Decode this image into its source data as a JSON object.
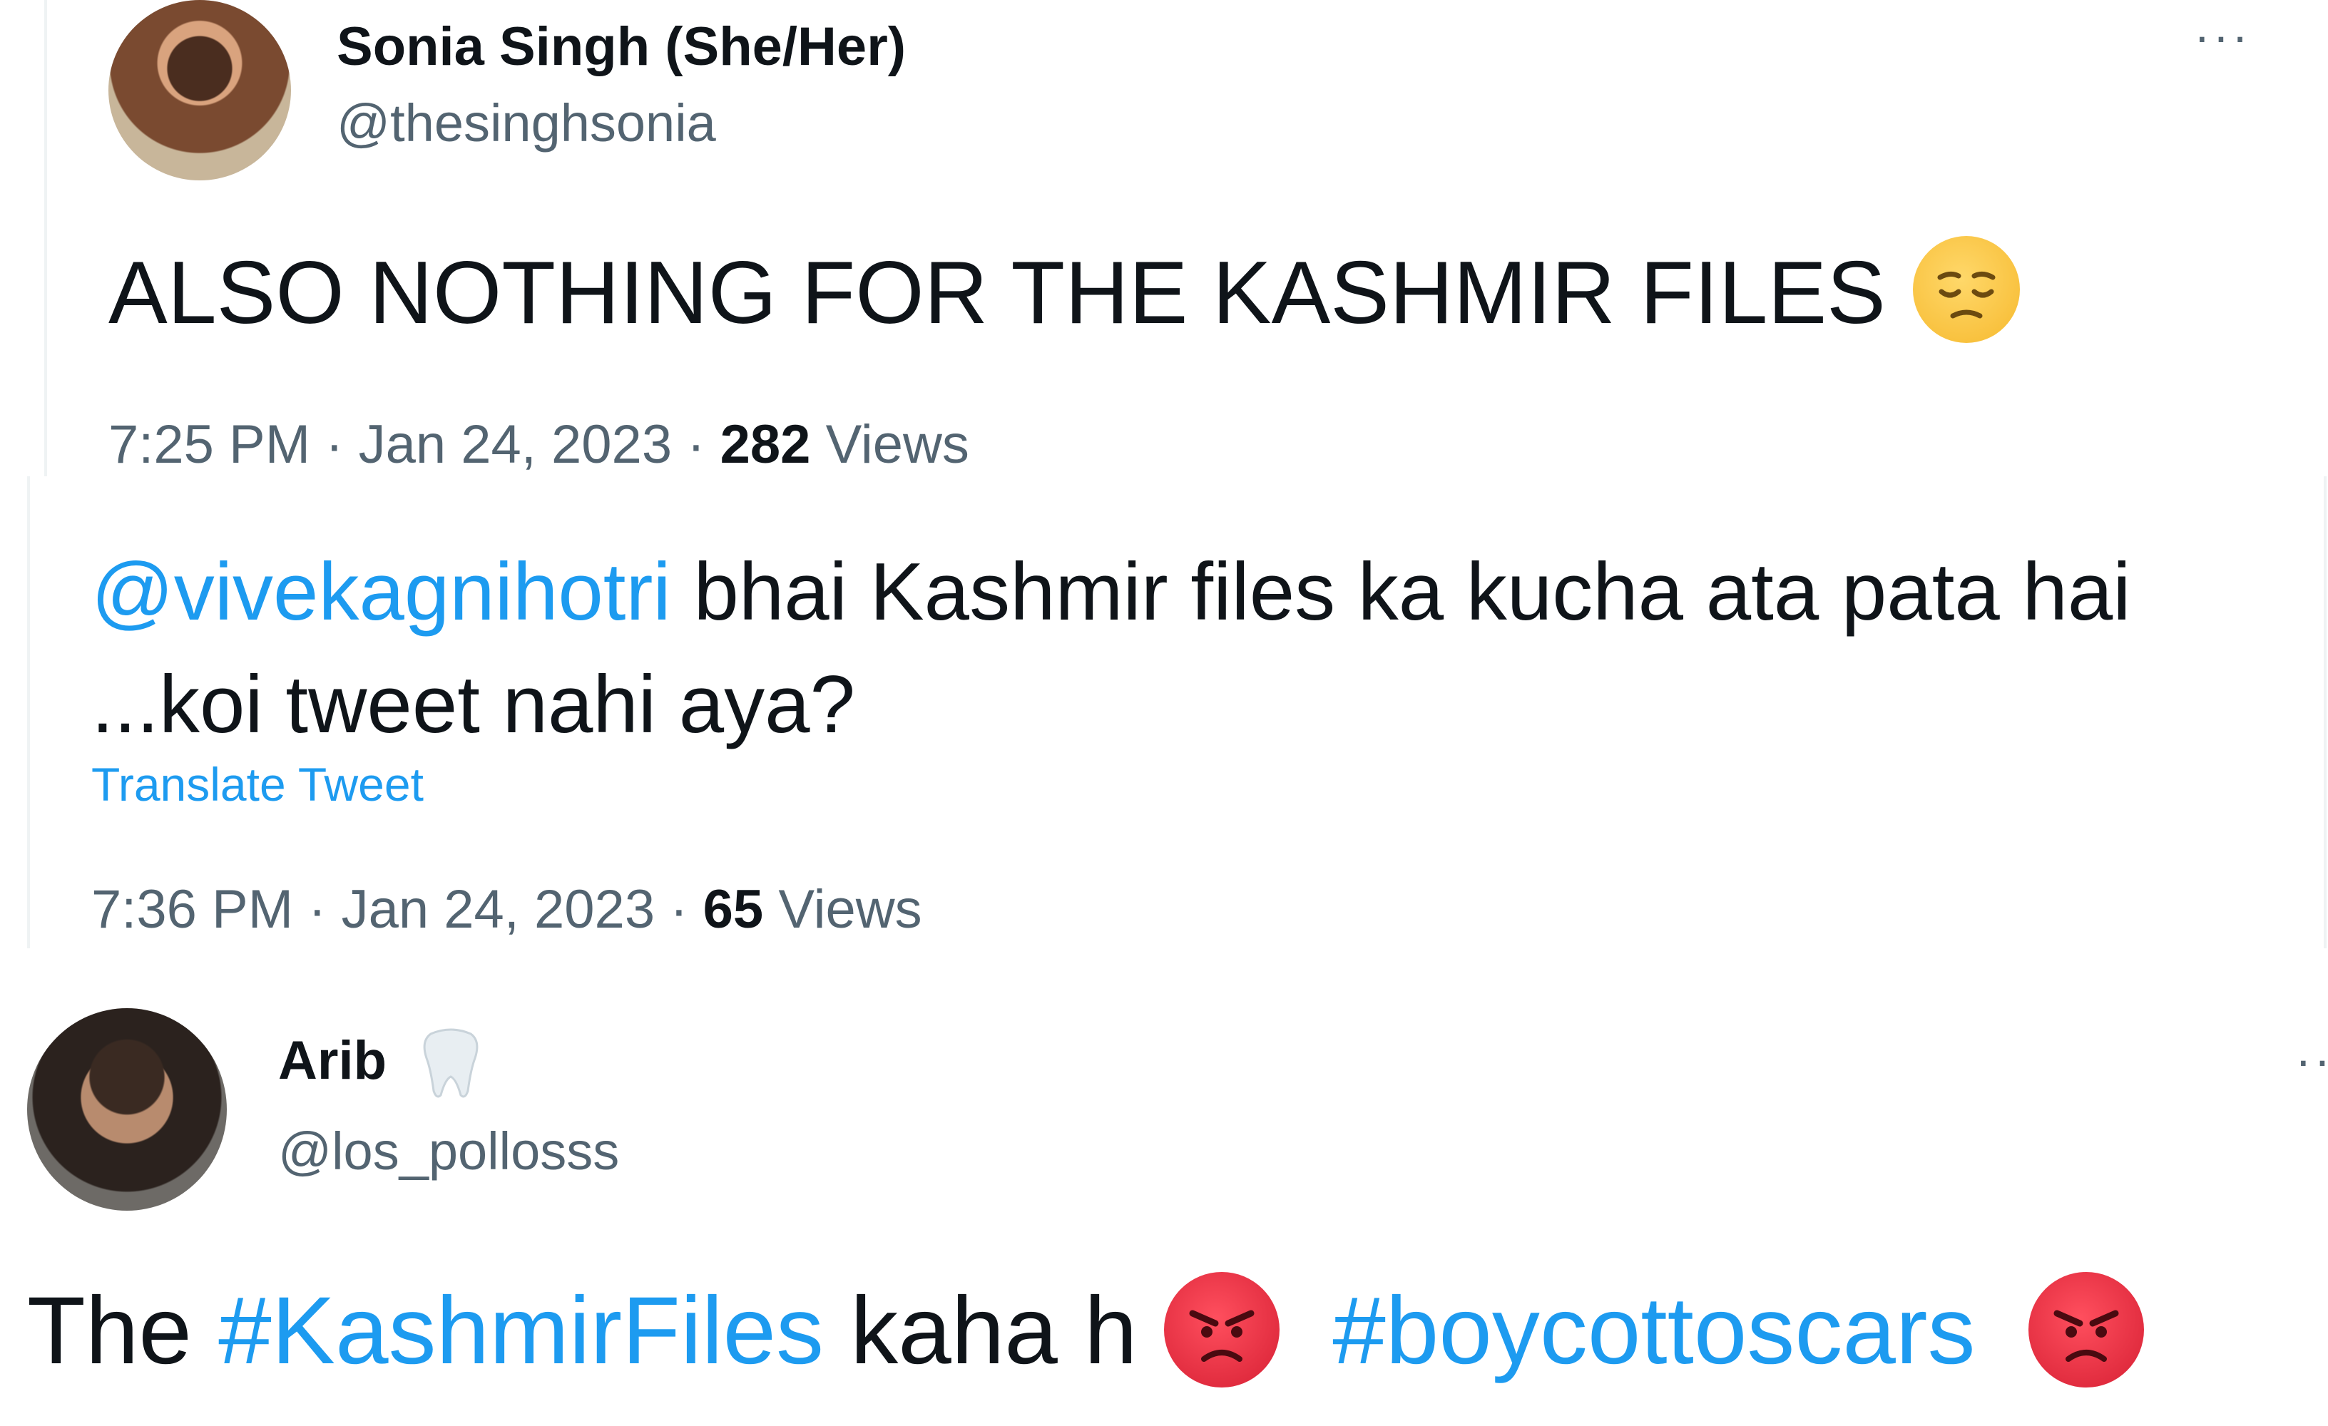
{
  "tweet1": {
    "author_name": "Sonia Singh (She/Her)",
    "author_handle": "@thesinghsonia",
    "more": "···",
    "text": "ALSO NOTHING FOR THE KASHMIR FILES",
    "emoji": "pensive-face",
    "time": "7:25 PM",
    "separator": " · ",
    "date": "Jan 24, 2023",
    "views_count": "282",
    "views_label": "Views"
  },
  "tweet2": {
    "mention": "@vivekagnihotri",
    "text": " bhai Kashmir files ka kucha ata pata hai ...koi tweet nahi aya?",
    "translate_label": "Translate Tweet",
    "time": "7:36 PM",
    "separator": " · ",
    "date": "Jan 24, 2023",
    "views_count": "65",
    "views_label": "Views"
  },
  "tweet3": {
    "author_name": "Arib",
    "name_emoji": "tooth",
    "author_handle": "@los_pollosss",
    "more": "··",
    "text_before": "The ",
    "hashtag1": "#KashmirFiles",
    "text_middle": " kaha h ",
    "hashtag2": "#boycottoscars",
    "emoji": "angry-face"
  },
  "colors": {
    "text_primary": "#0f1419",
    "text_secondary": "#536471",
    "link": "#1d9bf0",
    "divider": "#eff3f4"
  }
}
